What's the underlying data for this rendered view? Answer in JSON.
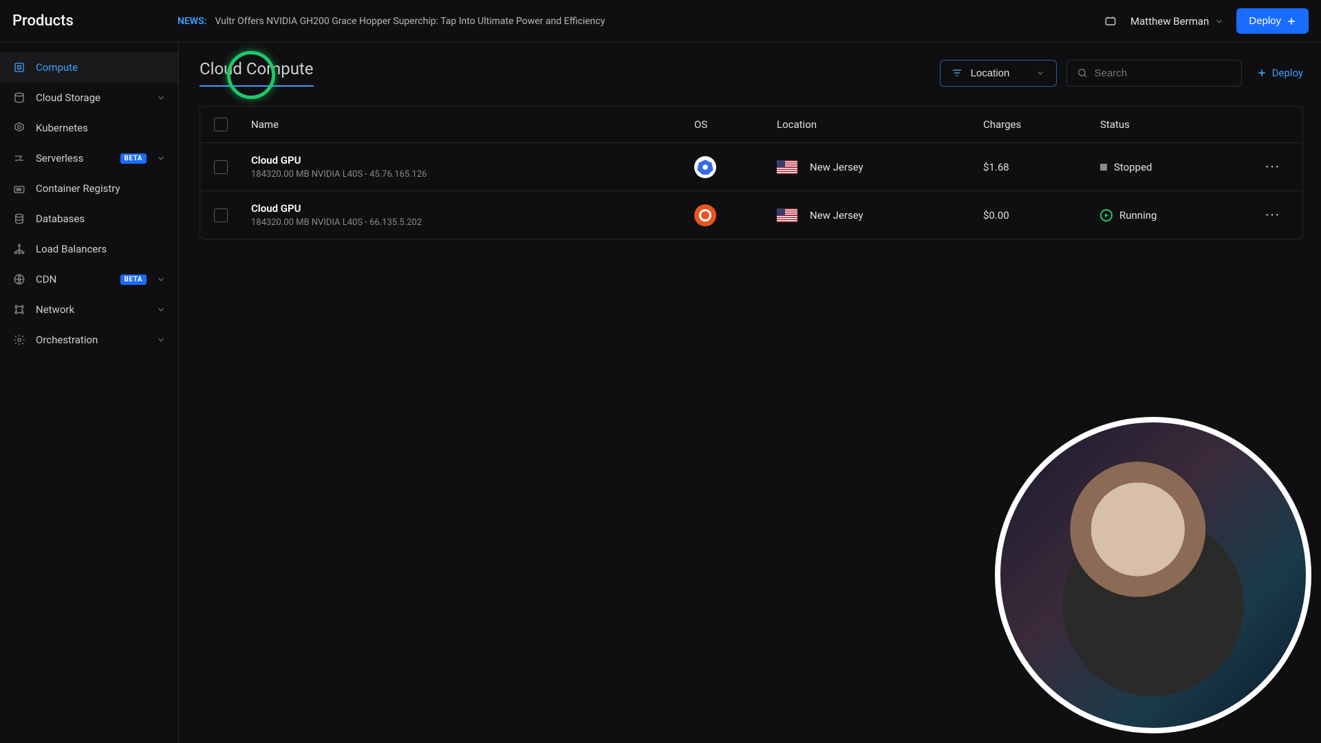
{
  "app_title": "Products",
  "news": {
    "label": "NEWS:",
    "text": "Vultr Offers NVIDIA GH200 Grace Hopper Superchip: Tap Into Ultimate Power and Efficiency"
  },
  "user": {
    "name": "Matthew Berman"
  },
  "deploy_button": "Deploy",
  "sidebar": {
    "items": [
      {
        "label": "Compute",
        "icon": "cpu",
        "active": true
      },
      {
        "label": "Cloud Storage",
        "icon": "storage",
        "expandable": true
      },
      {
        "label": "Kubernetes",
        "icon": "kubernetes"
      },
      {
        "label": "Serverless",
        "icon": "serverless",
        "beta": "BETA",
        "expandable": true
      },
      {
        "label": "Container Registry",
        "icon": "registry"
      },
      {
        "label": "Databases",
        "icon": "database"
      },
      {
        "label": "Load Balancers",
        "icon": "lb"
      },
      {
        "label": "CDN",
        "icon": "cdn",
        "beta": "BETA",
        "expandable": true
      },
      {
        "label": "Network",
        "icon": "network",
        "expandable": true
      },
      {
        "label": "Orchestration",
        "icon": "orchestration",
        "expandable": true
      }
    ]
  },
  "page": {
    "title": "Cloud Compute",
    "filter_label": "Location",
    "search_placeholder": "Search",
    "deploy_link": "Deploy"
  },
  "table": {
    "columns": {
      "name": "Name",
      "os": "OS",
      "location": "Location",
      "charges": "Charges",
      "status": "Status"
    },
    "rows": [
      {
        "name": "Cloud GPU",
        "sub": "184320.00 MB NVIDIA L40S - 45.76.165.126",
        "os": "kubernetes",
        "location": "New Jersey",
        "flag": "us",
        "charges": "$1.68",
        "status": "Stopped",
        "status_kind": "stopped"
      },
      {
        "name": "Cloud GPU",
        "sub": "184320.00 MB NVIDIA L40S - 66.135.5.202",
        "os": "ubuntu",
        "location": "New Jersey",
        "flag": "us",
        "charges": "$0.00",
        "status": "Running",
        "status_kind": "running"
      }
    ]
  }
}
